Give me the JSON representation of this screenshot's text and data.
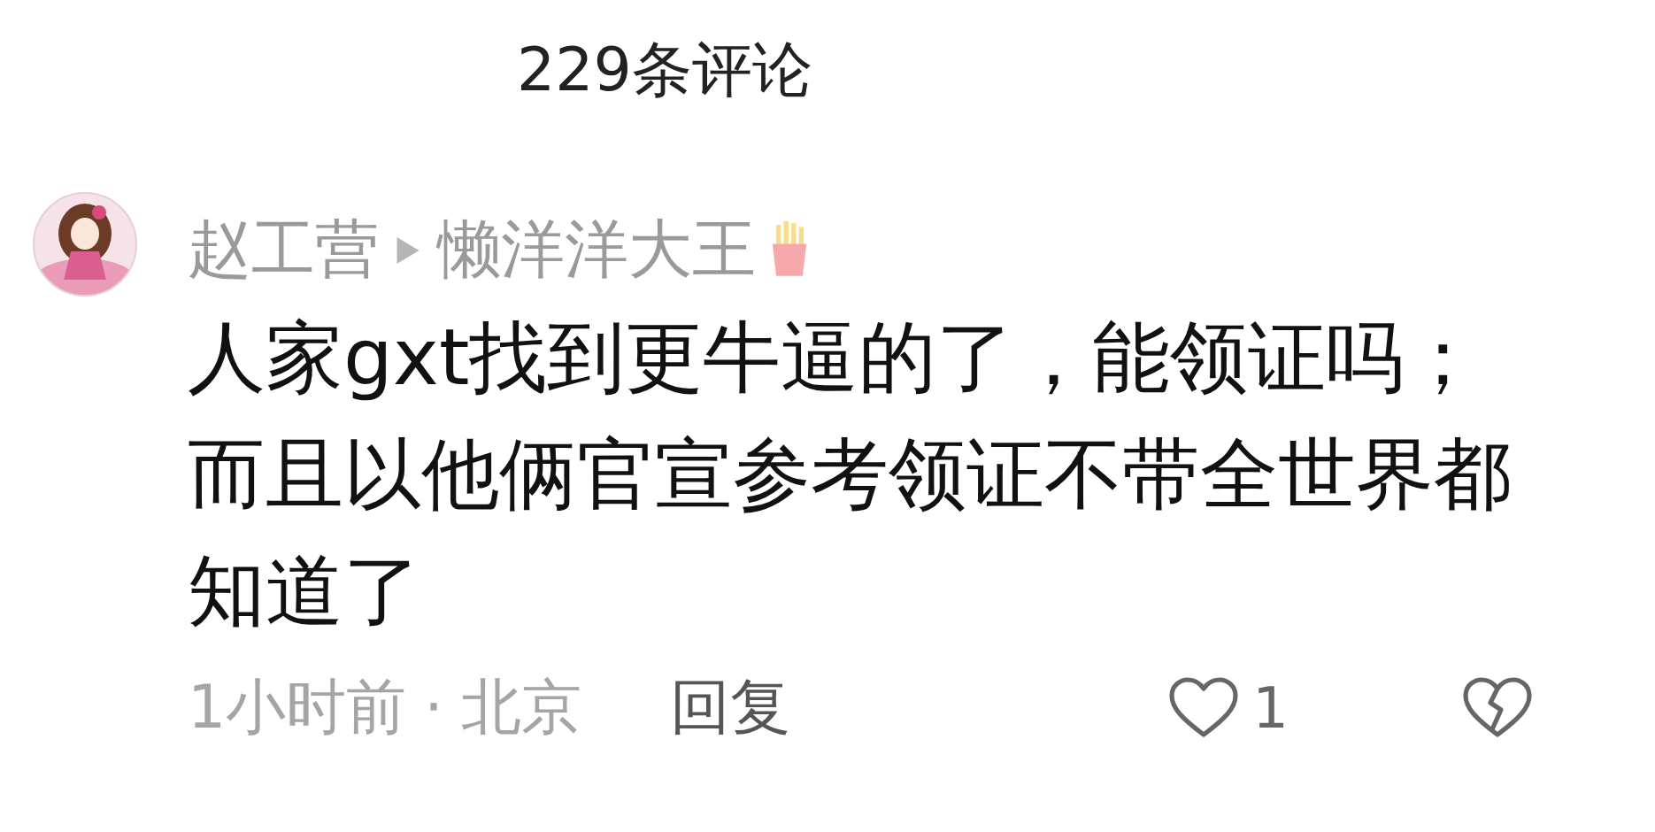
{
  "header": {
    "title": "229条评论"
  },
  "comment": {
    "author": "赵工营",
    "reply_to": "懒洋洋大王",
    "text_lines": [
      "人家gxt找到更牛逼的了，能领证吗；",
      "而且以他俩官宣参考领证不带全世界都知道了"
    ],
    "time": "1小时前",
    "separator": "·",
    "location": "北京",
    "reply": "回复",
    "likes": "1"
  }
}
